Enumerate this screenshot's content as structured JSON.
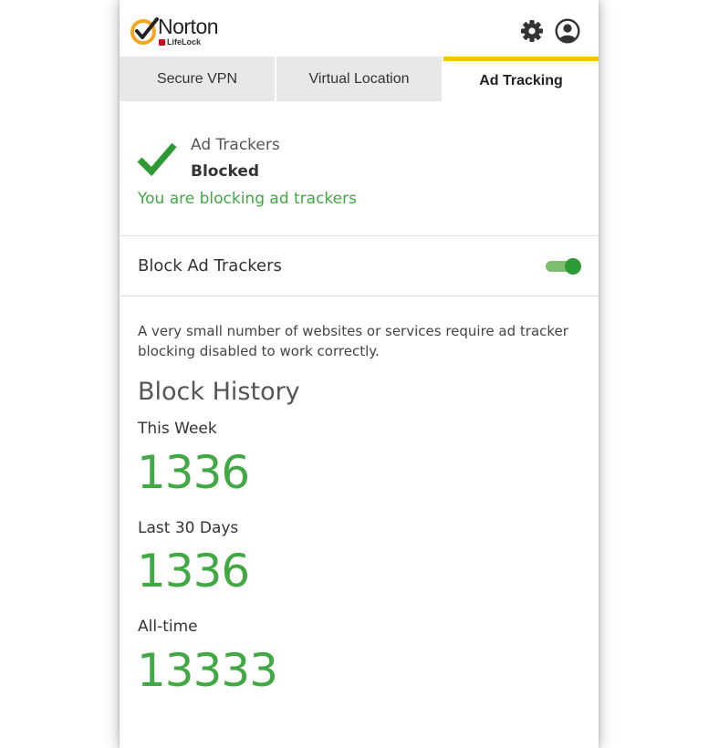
{
  "brand": {
    "name": "Norton",
    "sub": "LifeLock",
    "accent_color": "#f5c400",
    "check_color": "#f5a623",
    "lock_color": "#d6001c"
  },
  "header": {
    "settings_icon": "gear-icon",
    "account_icon": "account-icon"
  },
  "tabs": [
    {
      "label": "Secure VPN",
      "active": false
    },
    {
      "label": "Virtual Location",
      "active": false
    },
    {
      "label": "Ad Tracking",
      "active": true
    }
  ],
  "status": {
    "icon": "checkmark-icon",
    "title": "Ad Trackers",
    "value": "Blocked",
    "message": "You are blocking ad trackers",
    "color": "#41a843"
  },
  "toggle": {
    "label": "Block Ad Trackers",
    "enabled": true
  },
  "description": "A very small number of websites or services require ad tracker blocking disabled to work correctly.",
  "history": {
    "title": "Block History",
    "stats": [
      {
        "label": "This Week",
        "value": "1336"
      },
      {
        "label": "Last 30 Days",
        "value": "1336"
      },
      {
        "label": "All-time",
        "value": "13333"
      }
    ]
  }
}
